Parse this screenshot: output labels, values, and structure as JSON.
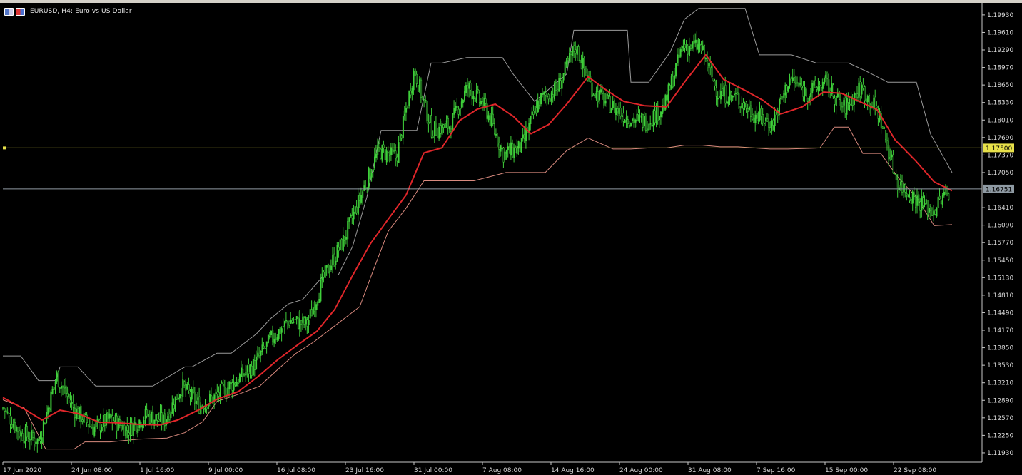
{
  "window": {
    "title": "EURUSD, H4:  Euro vs US Dollar"
  },
  "colors": {
    "background": "#000000",
    "candle": "#3fcf3a",
    "moving_average": "#e0262a",
    "upper_band": "#9a9a9a",
    "lower_band": "#d98a7e",
    "horizontal_line": "#e8e14a",
    "price_line": "#8f9aa3",
    "axis": "#c8c8c8"
  },
  "chart_data": {
    "type": "candlestick",
    "symbol": "EURUSD",
    "timeframe": "H4",
    "ylim": [
      1.1176,
      1.2015
    ],
    "y_ticks": [
      1.1993,
      1.1961,
      1.1929,
      1.1897,
      1.1865,
      1.1833,
      1.1801,
      1.1769,
      1.1737,
      1.1705,
      1.1673,
      1.1641,
      1.1609,
      1.1577,
      1.1545,
      1.1513,
      1.1481,
      1.1449,
      1.1417,
      1.1385,
      1.1353,
      1.1321,
      1.1289,
      1.1257,
      1.1225,
      1.1193
    ],
    "y_tick_labels": [
      "1.19930",
      "1.19610",
      "1.19290",
      "1.18970",
      "1.18650",
      "1.18330",
      "1.18010",
      "1.17690",
      "1.17370",
      "1.17050",
      "1.16730",
      "1.16410",
      "1.16090",
      "1.15770",
      "1.15450",
      "1.15130",
      "1.14810",
      "1.14490",
      "1.14170",
      "1.13850",
      "1.13530",
      "1.13210",
      "1.12890",
      "1.12570",
      "1.12250",
      "1.11930"
    ],
    "x_tick_labels": [
      "17 Jun 2020",
      "24 Jun 08:00",
      "1 Jul 16:00",
      "9 Jul 00:00",
      "16 Jul 08:00",
      "23 Jul 16:00",
      "31 Jul 00:00",
      "7 Aug 08:00",
      "14 Aug 16:00",
      "24 Aug 00:00",
      "31 Aug 08:00",
      "7 Sep 16:00",
      "15 Sep 00:00",
      "22 Sep 08:00"
    ],
    "horizontal_line": {
      "value": 1.175,
      "label": "1.17500"
    },
    "current_price": {
      "value": 1.16751,
      "label": "1.16751"
    },
    "series": [
      {
        "kind": "candles",
        "x": [
          0,
          25.1,
          50.1,
          75.3,
          100.3,
          125.4,
          150.4,
          175.5,
          200.5,
          225.6,
          250.7,
          275.7,
          300.7,
          325.8,
          350.8,
          375.9,
          400.9,
          426.0,
          451.0,
          476.0,
          501.1,
          526.1,
          551.2,
          576.2,
          601.3,
          626.4,
          651.4,
          676.4,
          701.5,
          726.5,
          751.6,
          776.6,
          801.7,
          826.7,
          851.8,
          876.8,
          901.9,
          926.9,
          952.0,
          977.0,
          1002.1,
          1027.1,
          1052.2,
          1077.2,
          1102.3,
          1127.3,
          1152.4,
          1177.4,
          1202.5,
          1227.5,
          1252.6,
          1277.6,
          1302.7,
          1327.7
        ],
        "values": [
          1.1275,
          1.1228,
          1.1215,
          1.1333,
          1.1272,
          1.1238,
          1.1255,
          1.1235,
          1.1262,
          1.125,
          1.1315,
          1.1279,
          1.1298,
          1.1324,
          1.1352,
          1.1401,
          1.1435,
          1.1428,
          1.1518,
          1.1578,
          1.1661,
          1.1745,
          1.1732,
          1.1893,
          1.1782,
          1.1791,
          1.1862,
          1.1822,
          1.1738,
          1.1752,
          1.1838,
          1.1857,
          1.1935,
          1.1855,
          1.1828,
          1.1804,
          1.1798,
          1.1826,
          1.1935,
          1.1935,
          1.185,
          1.1843,
          1.1812,
          1.1793,
          1.1876,
          1.185,
          1.187,
          1.1822,
          1.186,
          1.1812,
          1.1688,
          1.1658,
          1.1635,
          1.1675
        ]
      },
      {
        "kind": "moving_average",
        "x": [
          0,
          30,
          55,
          80,
          105,
          135,
          160,
          190,
          220,
          245,
          275,
          300,
          330,
          360,
          385,
          415,
          440,
          465,
          490,
          515,
          540,
          565,
          590,
          615,
          640,
          665,
          690,
          715,
          740,
          765,
          790,
          820,
          845,
          870,
          900,
          930,
          955,
          985,
          1010,
          1040,
          1065,
          1090,
          1120,
          1150,
          1175,
          1200,
          1225,
          1250,
          1280,
          1305,
          1330
        ],
        "values": [
          1.1294,
          1.1273,
          1.1253,
          1.1271,
          1.1265,
          1.1249,
          1.1248,
          1.1245,
          1.1244,
          1.1253,
          1.1272,
          1.1291,
          1.1305,
          1.1335,
          1.1363,
          1.1392,
          1.1415,
          1.1455,
          1.1517,
          1.1575,
          1.162,
          1.1664,
          1.1741,
          1.175,
          1.18,
          1.1821,
          1.183,
          1.1808,
          1.1776,
          1.1793,
          1.183,
          1.188,
          1.1856,
          1.1835,
          1.1827,
          1.1825,
          1.187,
          1.192,
          1.1875,
          1.1855,
          1.1837,
          1.1812,
          1.1825,
          1.1852,
          1.185,
          1.1835,
          1.182,
          1.1765,
          1.1725,
          1.1688,
          1.1672
        ]
      },
      {
        "kind": "upper_band",
        "x": [
          0,
          25,
          50,
          75,
          80,
          105,
          130,
          155,
          210,
          255,
          265,
          300,
          320,
          355,
          375,
          400,
          420,
          450,
          470,
          490,
          510,
          530,
          580,
          600,
          615,
          650,
          700,
          715,
          745,
          790,
          800,
          840,
          875,
          880,
          905,
          935,
          955,
          975,
          990,
          1040,
          1060,
          1105,
          1140,
          1185,
          1210,
          1240,
          1280,
          1300,
          1330
        ],
        "values": [
          1.137,
          1.137,
          1.1325,
          1.1325,
          1.135,
          1.135,
          1.1315,
          1.1315,
          1.1315,
          1.135,
          1.135,
          1.1375,
          1.1375,
          1.141,
          1.1438,
          1.1465,
          1.1473,
          1.1518,
          1.1518,
          1.157,
          1.166,
          1.1782,
          1.1782,
          1.1905,
          1.1905,
          1.1915,
          1.1915,
          1.1885,
          1.1835,
          1.1885,
          1.1965,
          1.1965,
          1.1965,
          1.187,
          1.187,
          1.1925,
          1.1985,
          1.2005,
          1.2005,
          1.2005,
          1.192,
          1.192,
          1.1905,
          1.1905,
          1.189,
          1.187,
          1.187,
          1.1775,
          1.1705
        ]
      },
      {
        "kind": "lower_band",
        "x": [
          0,
          30,
          60,
          100,
          115,
          150,
          190,
          230,
          255,
          280,
          300,
          330,
          360,
          385,
          410,
          435,
          460,
          480,
          500,
          520,
          540,
          565,
          590,
          610,
          660,
          705,
          735,
          760,
          790,
          820,
          855,
          880,
          905,
          930,
          955,
          980,
          1005,
          1030,
          1075,
          1100,
          1145,
          1165,
          1185,
          1205,
          1230,
          1255,
          1280,
          1305,
          1330
        ],
        "values": [
          1.129,
          1.1275,
          1.12,
          1.12,
          1.1213,
          1.1213,
          1.1218,
          1.122,
          1.123,
          1.125,
          1.1287,
          1.13,
          1.1315,
          1.1345,
          1.1374,
          1.1395,
          1.142,
          1.144,
          1.146,
          1.153,
          1.1598,
          1.164,
          1.169,
          1.169,
          1.169,
          1.1705,
          1.1705,
          1.1705,
          1.1745,
          1.1768,
          1.1748,
          1.1748,
          1.175,
          1.175,
          1.1755,
          1.1755,
          1.1752,
          1.1752,
          1.1748,
          1.1748,
          1.175,
          1.1788,
          1.1788,
          1.174,
          1.174,
          1.1695,
          1.166,
          1.1608,
          1.161
        ]
      }
    ]
  }
}
